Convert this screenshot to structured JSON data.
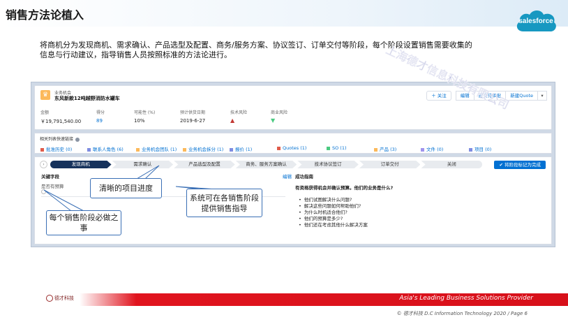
{
  "slide": {
    "title": "销售方法论植入",
    "intro": "将商机分为发现商机、需求确认、产品选型及配置、商务/服务方案、协议签订、订单交付等阶段，每个阶段设置销售需要收集的信息与行动建议，指导销售人员按照标准的方法论进行。",
    "brand": "salesforce",
    "watermark": "上海德才信息科技有限公司"
  },
  "record": {
    "type_label": "业务机会",
    "name": "东风新款12吨越野消防水罐车",
    "buttons": {
      "follow": "＋ 关注",
      "edit": "编辑",
      "submit": "提交待审批",
      "new_quote": "新建Quote"
    },
    "fields": [
      {
        "label": "金额",
        "value": "￥19,791,540.00"
      },
      {
        "label": "得分",
        "value": "89"
      },
      {
        "label": "可能性 (%)",
        "value": "10%"
      },
      {
        "label": "预计供货日期",
        "value": "2019-6-27"
      },
      {
        "label": "技术风险",
        "value": "▲"
      },
      {
        "label": "商业风险",
        "value": "▼"
      }
    ]
  },
  "related": {
    "title": "相关列表快速链接",
    "links": [
      {
        "label": "批准历史 (0)",
        "color": "#e05b4a"
      },
      {
        "label": "联系人角色 (6)",
        "color": "#7f8de1"
      },
      {
        "label": "业务机会团队 (1)",
        "color": "#fcb95b"
      },
      {
        "label": "业务机会拆分 (1)",
        "color": "#fcb95b"
      },
      {
        "label": "报价 (1)",
        "color": "#7f8de1"
      },
      {
        "label": "Quotes (1)",
        "color": "#e05b4a"
      },
      {
        "label": "SO (1)",
        "color": "#4bca81"
      },
      {
        "label": "产品 (3)",
        "color": "#fcb95b"
      },
      {
        "label": "文件 (0)",
        "color": "#a094ed"
      },
      {
        "label": "项目 (0)",
        "color": "#7f8de1"
      }
    ]
  },
  "path": {
    "stages": [
      "发现商机",
      "需求确认",
      "产品选型及配置",
      "商务、服务方案确认",
      "技术协议签订",
      "订单交付",
      "关闭"
    ],
    "active_index": 0,
    "mark_button": "✔ 将阶段标记为完成",
    "key_fields_title": "关键字段",
    "key_field_label": "是否有预算",
    "edit": "编辑",
    "guide_title": "成功指南",
    "guide_question": "有资格获得机会并确认预算。他们的业务是什么?",
    "guide_items": [
      "他们试图解决什么问题?",
      "解决这些问题如何帮助他们?",
      "为什么时机适合他们?",
      "他们的预算是多少?",
      "他们还在考虑其他什么解决方案"
    ]
  },
  "callouts": {
    "progress": "清晰的项目进度",
    "guidance": "系统可在各销售阶段提供销售指导",
    "stage_actions": "每个销售阶段必做之事"
  },
  "footer": {
    "logo_text": "德才科技",
    "tagline": "Asia's Leading Business Solutions Provider",
    "copyright": "© 德才科技 D.C Information Technology 2020  /  Page 6"
  }
}
